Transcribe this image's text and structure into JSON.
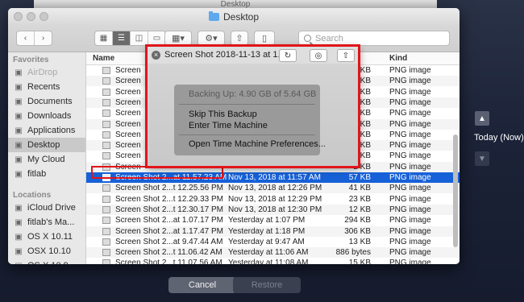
{
  "background_window": {
    "title": "Desktop"
  },
  "window": {
    "title": "Desktop"
  },
  "search": {
    "placeholder": "Search"
  },
  "sidebar": {
    "favorites_label": "Favorites",
    "favorites": [
      {
        "label": "AirDrop",
        "icon": "airdrop-icon",
        "dim": true
      },
      {
        "label": "Recents",
        "icon": "clock-icon"
      },
      {
        "label": "Documents",
        "icon": "document-icon"
      },
      {
        "label": "Downloads",
        "icon": "download-icon"
      },
      {
        "label": "Applications",
        "icon": "applications-icon"
      },
      {
        "label": "Desktop",
        "icon": "desktop-icon",
        "selected": true
      },
      {
        "label": "My Cloud",
        "icon": "folder-icon"
      },
      {
        "label": "fitlab",
        "icon": "home-icon"
      }
    ],
    "locations_label": "Locations",
    "locations": [
      {
        "label": "iCloud Drive",
        "icon": "cloud-icon"
      },
      {
        "label": "fitlab's Ma...",
        "icon": "laptop-icon"
      },
      {
        "label": "OS X 10.11",
        "icon": "disk-icon"
      },
      {
        "label": "OSX 10.10",
        "icon": "disk-icon"
      },
      {
        "label": "OS X 10.9",
        "icon": "disk-icon"
      }
    ]
  },
  "list": {
    "columns": {
      "name": "Name",
      "kind": "Kind"
    },
    "rows": [
      {
        "name": "Screen",
        "date": "",
        "size": "1 KB",
        "kind": "PNG image"
      },
      {
        "name": "Screen",
        "date": "",
        "size": "3 KB",
        "kind": "PNG image"
      },
      {
        "name": "Screen",
        "date": "",
        "size": "3 KB",
        "kind": "PNG image"
      },
      {
        "name": "Screen",
        "date": "",
        "size": "2 KB",
        "kind": "PNG image"
      },
      {
        "name": "Screen",
        "date": "",
        "size": "7 KB",
        "kind": "PNG image"
      },
      {
        "name": "Screen",
        "date": "",
        "size": "2 KB",
        "kind": "PNG image"
      },
      {
        "name": "Screen",
        "date": "",
        "size": "3 KB",
        "kind": "PNG image"
      },
      {
        "name": "Screen",
        "date": "",
        "size": "2 KB",
        "kind": "PNG image"
      },
      {
        "name": "Screen",
        "date": "",
        "size": "4 KB",
        "kind": "PNG image"
      },
      {
        "name": "Screen",
        "date": "",
        "size": "2 KB",
        "kind": "PNG image"
      },
      {
        "name": "Screen Shot 2...at 11.57.23 AM",
        "date": "Nov 13, 2018 at 11:57 AM",
        "size": "57 KB",
        "kind": "PNG image",
        "selected": true
      },
      {
        "name": "Screen Shot 2...t 12.25.56 PM",
        "date": "Nov 13, 2018 at 12:26 PM",
        "size": "41 KB",
        "kind": "PNG image"
      },
      {
        "name": "Screen Shot 2...t 12.29.33 PM",
        "date": "Nov 13, 2018 at 12:29 PM",
        "size": "23 KB",
        "kind": "PNG image"
      },
      {
        "name": "Screen Shot 2...t 12.30.17 PM",
        "date": "Nov 13, 2018 at 12:30 PM",
        "size": "12 KB",
        "kind": "PNG image"
      },
      {
        "name": "Screen Shot 2...at 1.07.17 PM",
        "date": "Yesterday at 1:07 PM",
        "size": "294 KB",
        "kind": "PNG image"
      },
      {
        "name": "Screen Shot 2...at 1.17.47 PM",
        "date": "Yesterday at 1:18 PM",
        "size": "306 KB",
        "kind": "PNG image"
      },
      {
        "name": "Screen Shot 2...at 9.47.44 AM",
        "date": "Yesterday at 9:47 AM",
        "size": "13 KB",
        "kind": "PNG image"
      },
      {
        "name": "Screen Shot 2...t 11.06.42 AM",
        "date": "Yesterday at 11:06 AM",
        "size": "886 bytes",
        "kind": "PNG image"
      },
      {
        "name": "Screen Shot 2...t 11.07.56 AM",
        "date": "Yesterday at 11:08 AM",
        "size": "15 KB",
        "kind": "PNG image"
      }
    ]
  },
  "popup": {
    "title": "Screen Shot 2018-11-13 at 1...",
    "menu": {
      "backing_up": "Backing Up: 4.90 GB of 5.64 GB",
      "skip": "Skip This Backup",
      "enter": "Enter Time Machine",
      "prefs": "Open Time Machine Preferences..."
    }
  },
  "timeline": {
    "today_label": "Today (Now)"
  },
  "buttons": {
    "cancel": "Cancel",
    "restore": "Restore"
  },
  "colors": {
    "accent": "#1761d8",
    "highlight": "#e1141a"
  }
}
